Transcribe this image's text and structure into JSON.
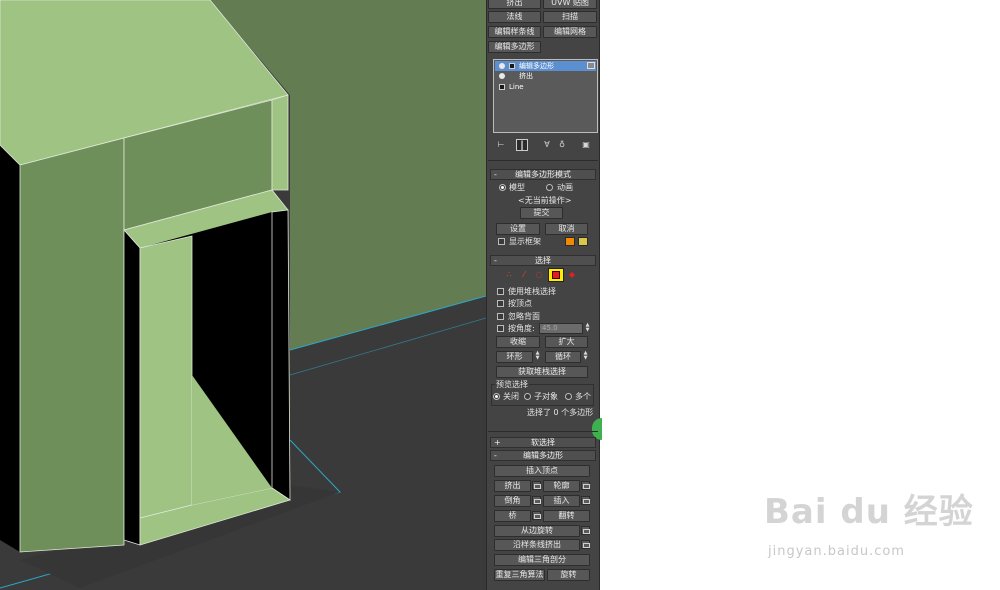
{
  "modifier_buttons": [
    {
      "label": "挤出"
    },
    {
      "label": "UVW 贴图"
    },
    {
      "label": "法线"
    },
    {
      "label": "扫描"
    },
    {
      "label": "编辑样条线"
    },
    {
      "label": "编辑网格"
    },
    {
      "label": "编辑多边形"
    }
  ],
  "stack": {
    "items": [
      {
        "label": "编辑多边形",
        "selected": true
      },
      {
        "label": "挤出",
        "selected": false
      },
      {
        "label": "Line",
        "selected": false
      }
    ]
  },
  "edit_poly_mode": {
    "title": "编辑多边形模式",
    "model_label": "模型",
    "animate_label": "动画",
    "no_op_label": "<无当前操作>",
    "commit_label": "提交",
    "settings_label": "设置",
    "cancel_label": "取消",
    "show_cage_label": "显示框架",
    "cage_colors": [
      "#f08a00",
      "#d8c84a"
    ]
  },
  "selection": {
    "title": "选择",
    "use_stack_label": "使用堆栈选择",
    "by_vertex_label": "按顶点",
    "ignore_back_label": "忽略背面",
    "by_angle_label": "按角度:",
    "angle_value": "45.0",
    "shrink_label": "收缩",
    "grow_label": "扩大",
    "ring_label": "环形",
    "loop_label": "循环",
    "get_stack_label": "获取堆栈选择",
    "preview_title": "预览选择",
    "preview_off": "关闭",
    "preview_sub": "子对象",
    "preview_multi": "多个",
    "status": "选择了 0 个多边形",
    "highlight_color": "#ffee00"
  },
  "soft_selection": {
    "title": "软选择"
  },
  "edit_polygons": {
    "title": "编辑多边形",
    "insert_vertex": "插入顶点",
    "extrude": "挤出",
    "outline": "轮廓",
    "bevel": "倒角",
    "inset": "插入",
    "bridge": "桥",
    "flip": "翻转",
    "hinge": "从边旋转",
    "extrude_spline": "沿样条线挤出",
    "edit_tri": "编辑三角剖分",
    "retri": "重复三角算法",
    "turn": "旋转"
  },
  "viewport": {
    "background": "#3a3a3a",
    "wall_color": "#637c52",
    "light_green": "#9ec383",
    "mid_green": "#6e8f5a",
    "edge_color": "#2ea6c8"
  },
  "watermark": {
    "logo_text": "Bai du 经验",
    "url": "jingyan.baidu.com"
  }
}
